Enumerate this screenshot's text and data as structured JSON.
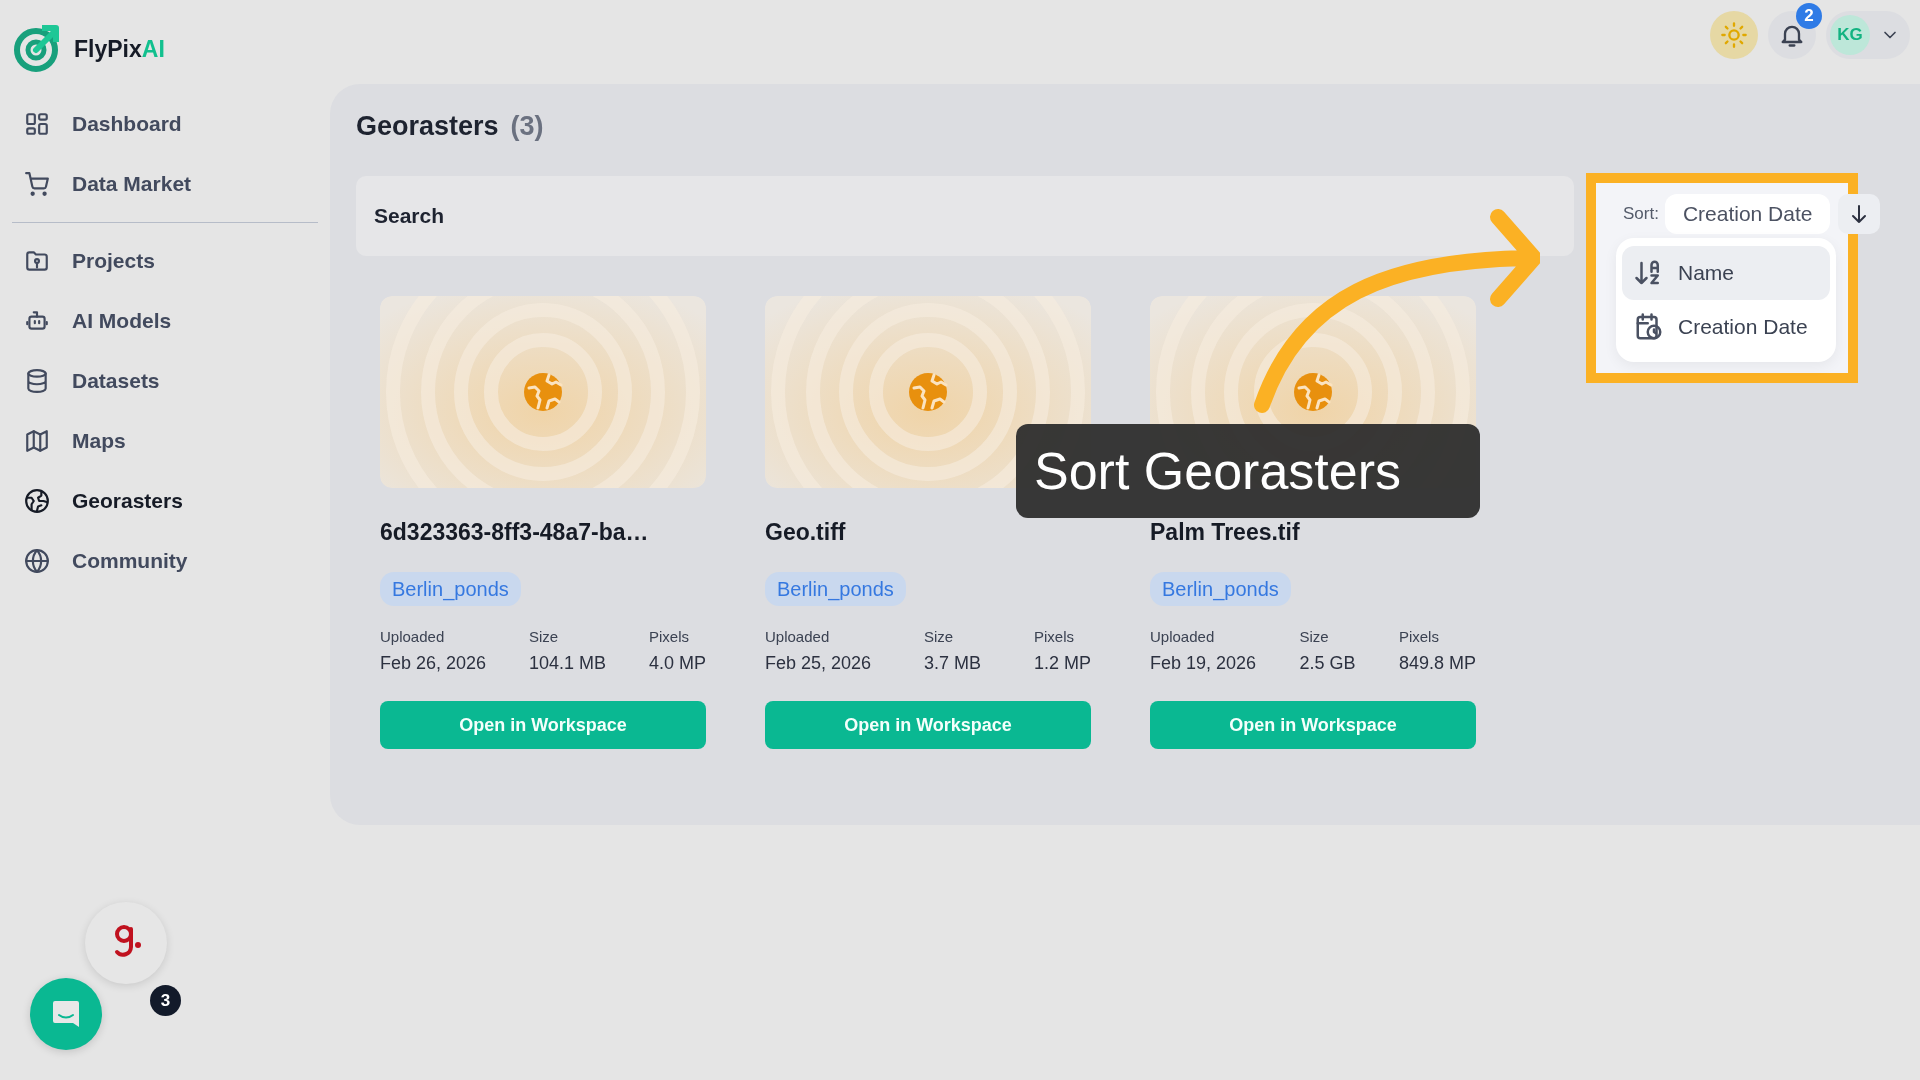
{
  "app": {
    "logo_text": "FlyPix",
    "logo_accent": "AI"
  },
  "header": {
    "notifications_badge": "2",
    "avatar_initials": "KG"
  },
  "sidebar": {
    "sections": [
      {
        "items": [
          {
            "label": "Dashboard",
            "kind": "dashboard",
            "selected": false
          },
          {
            "label": "Data Market",
            "kind": "cart",
            "selected": false
          }
        ]
      },
      {
        "items": [
          {
            "label": "Projects",
            "kind": "folder",
            "selected": false
          },
          {
            "label": "AI Models",
            "kind": "robot",
            "selected": false
          },
          {
            "label": "Datasets",
            "kind": "database",
            "selected": false
          },
          {
            "label": "Maps",
            "kind": "map",
            "selected": false
          },
          {
            "label": "Georasters",
            "kind": "earth",
            "selected": true
          },
          {
            "label": "Community",
            "kind": "globe",
            "selected": false
          }
        ]
      }
    ]
  },
  "page": {
    "title": "Georasters",
    "count": "(3)"
  },
  "search": {
    "placeholder": "Search"
  },
  "sort": {
    "label": "Sort:",
    "value": "Creation Date",
    "options": [
      {
        "label": "Name",
        "kind": "alpha",
        "highlighted": true
      },
      {
        "label": "Creation Date",
        "kind": "date",
        "highlighted": false
      }
    ]
  },
  "cards": [
    {
      "name": "6d323363-8ff3-48a7-ba…",
      "tag": "Berlin_ponds",
      "meta": [
        {
          "label": "Uploaded",
          "value": "Feb 26, 2026"
        },
        {
          "label": "Size",
          "value": "104.1 MB"
        },
        {
          "label": "Pixels",
          "value": "4.0 MP"
        }
      ],
      "button": "Open in Workspace"
    },
    {
      "name": "Geo.tiff",
      "tag": "Berlin_ponds",
      "meta": [
        {
          "label": "Uploaded",
          "value": "Feb 25, 2026"
        },
        {
          "label": "Size",
          "value": "3.7 MB"
        },
        {
          "label": "Pixels",
          "value": "1.2 MP"
        }
      ],
      "button": "Open in Workspace"
    },
    {
      "name": "Palm Trees.tif",
      "tag": "Berlin_ponds",
      "meta": [
        {
          "label": "Uploaded",
          "value": "Feb 19, 2026"
        },
        {
          "label": "Size",
          "value": "2.5 GB"
        },
        {
          "label": "Pixels",
          "value": "849.8 MP"
        }
      ],
      "button": "Open in Workspace"
    }
  ],
  "tutorial": {
    "tooltip": "Sort Georasters"
  },
  "widgets": {
    "review_badge": "3"
  }
}
